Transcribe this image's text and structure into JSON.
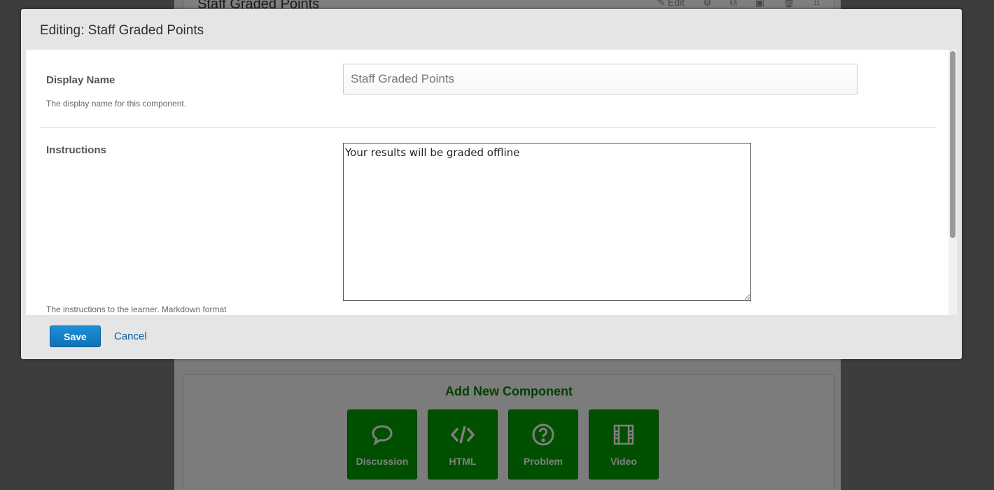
{
  "background": {
    "unit_title": "Staff Graded Points",
    "edit_label": "Edit",
    "add_component": {
      "title": "Add New Component",
      "buttons": [
        {
          "label": "Discussion",
          "icon": "discussion-icon"
        },
        {
          "label": "HTML",
          "icon": "code-icon"
        },
        {
          "label": "Problem",
          "icon": "question-icon"
        },
        {
          "label": "Video",
          "icon": "video-icon"
        }
      ]
    }
  },
  "modal": {
    "title": "Editing: Staff Graded Points",
    "fields": {
      "display_name": {
        "label": "Display Name",
        "value": "Staff Graded Points",
        "help": "The display name for this component."
      },
      "instructions": {
        "label": "Instructions",
        "value": "Your results will be graded offline",
        "help": "The instructions to the learner. Markdown format"
      }
    },
    "footer": {
      "save_label": "Save",
      "cancel_label": "Cancel"
    }
  },
  "colors": {
    "component_green": "#00a000",
    "add_title_green": "#008100",
    "save_blue": "#1a80c8",
    "link_blue": "#0a5fa0"
  }
}
